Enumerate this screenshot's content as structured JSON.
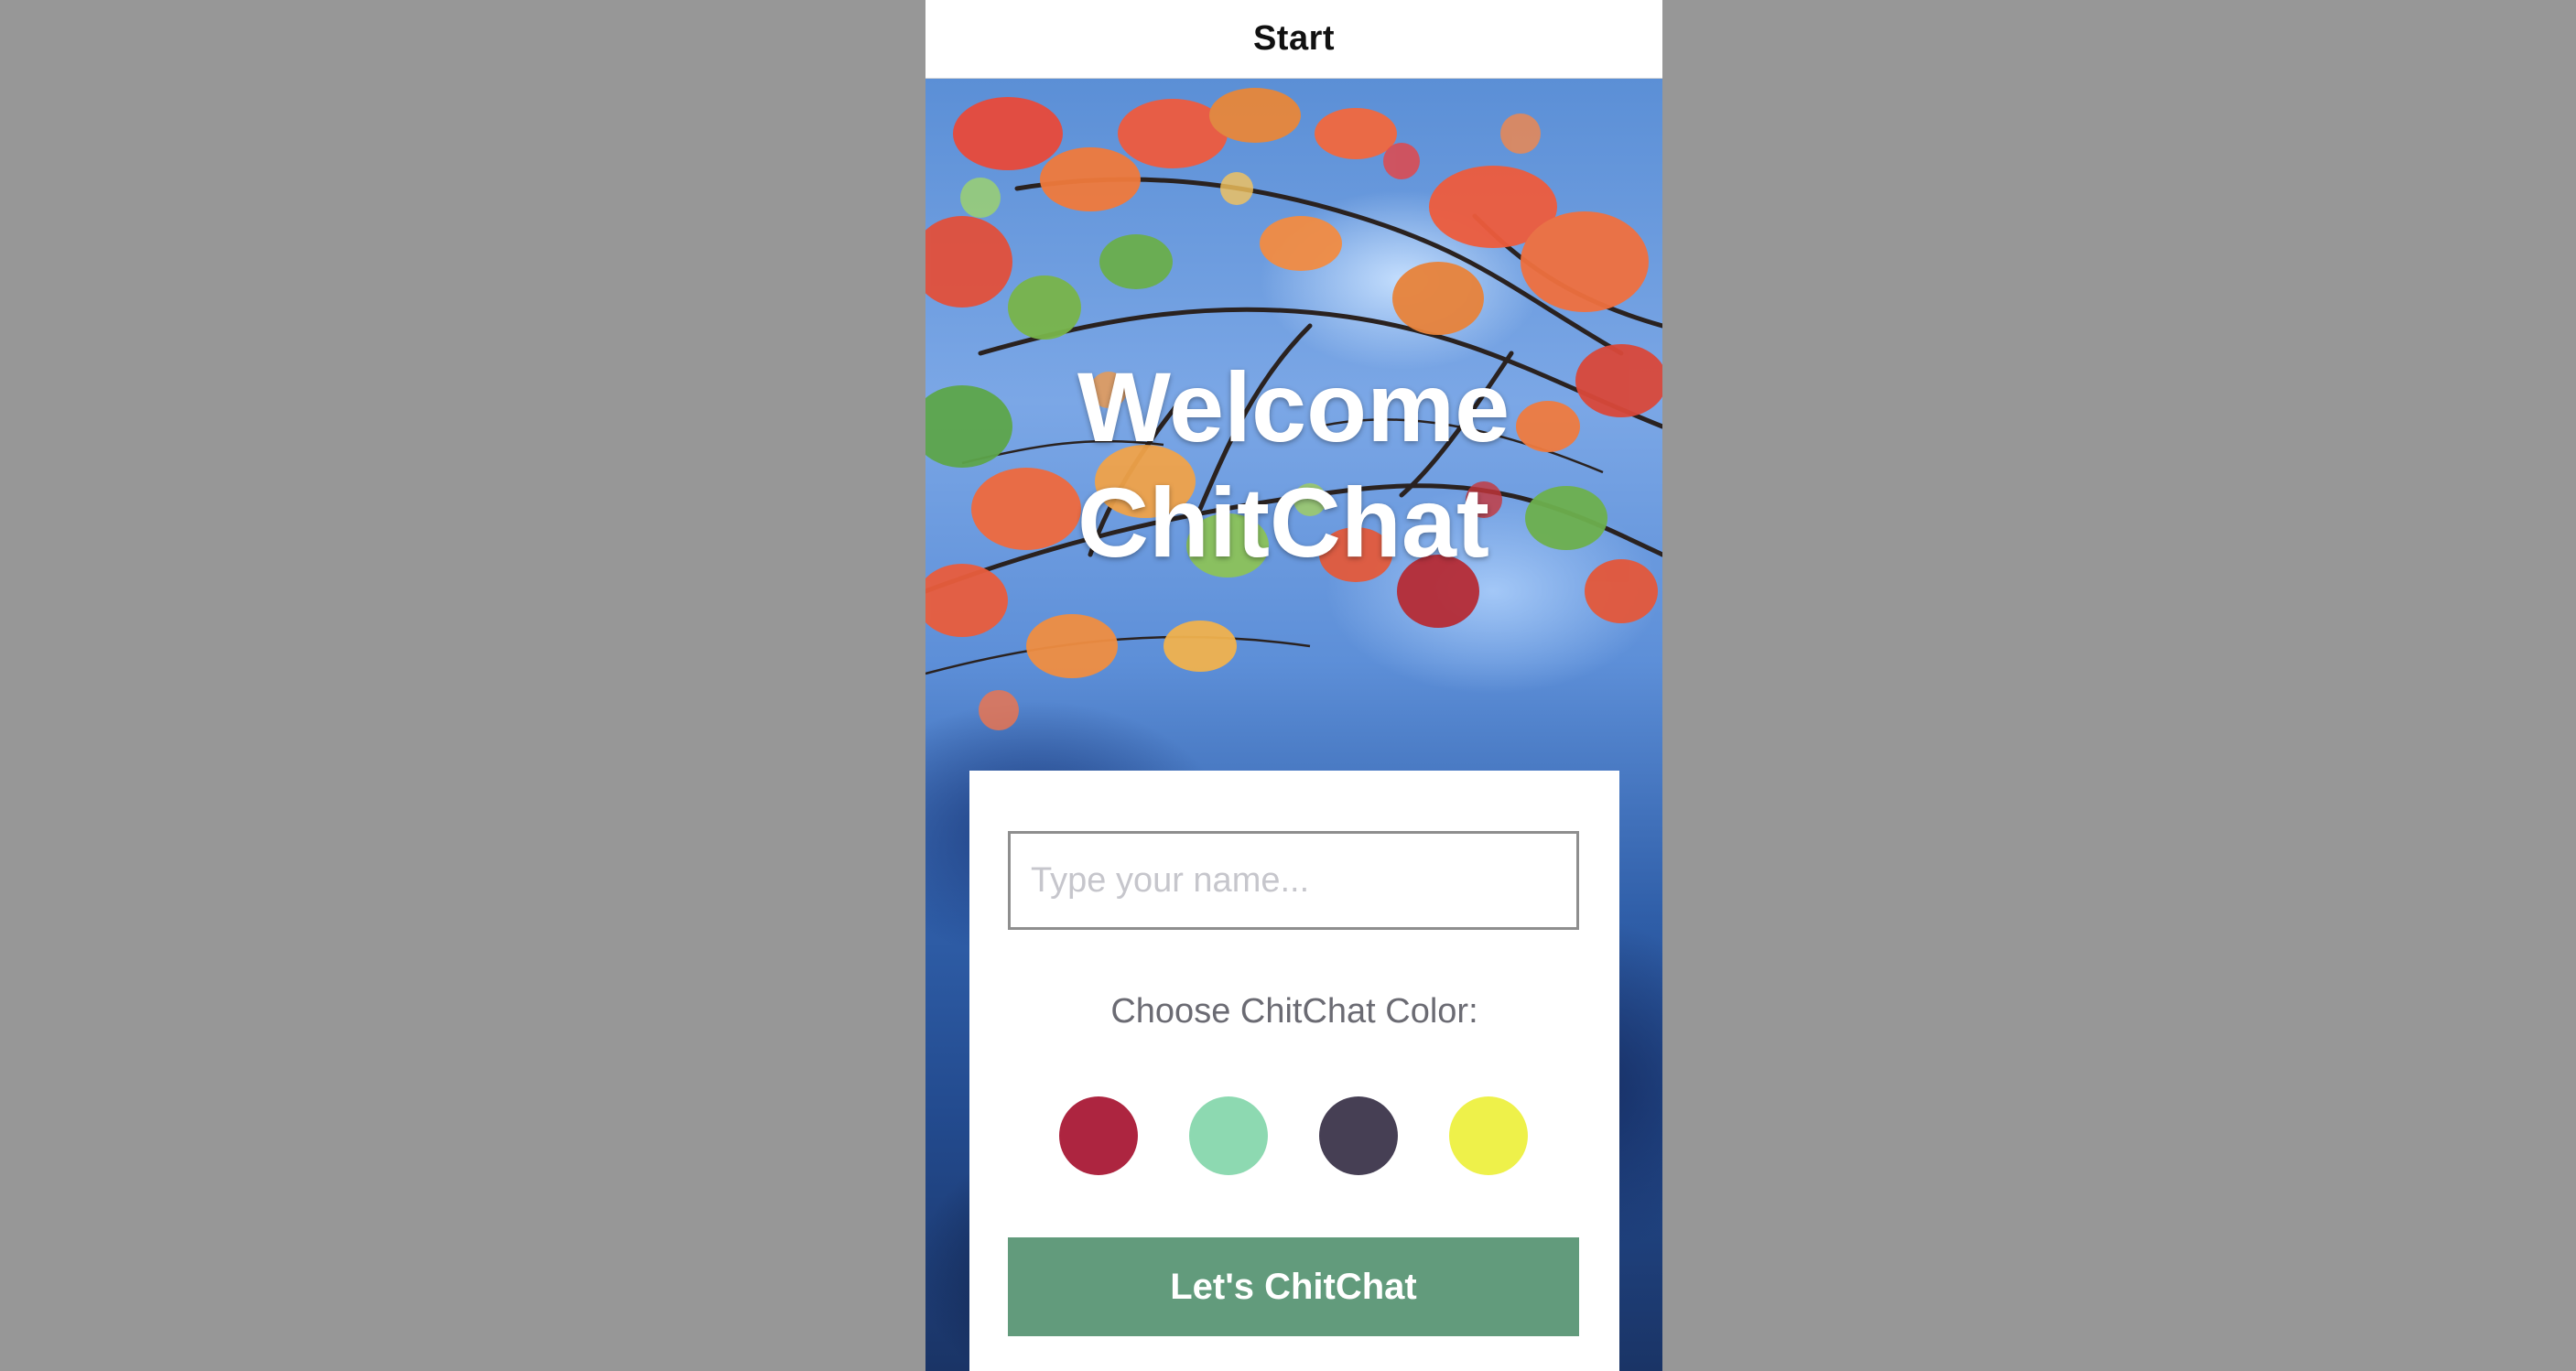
{
  "nav": {
    "title": "Start"
  },
  "hero": {
    "line1": "Welcome",
    "line2": "ChitChat"
  },
  "form": {
    "name_placeholder": "Type your name...",
    "name_value": "",
    "color_label": "Choose ChitChat Color:",
    "colors": [
      {
        "name": "crimson",
        "hex": "#ad2540"
      },
      {
        "name": "mint",
        "hex": "#8dd9b1"
      },
      {
        "name": "charcoal",
        "hex": "#463f54"
      },
      {
        "name": "yellow",
        "hex": "#eef14a"
      }
    ],
    "submit_label": "Let's ChitChat"
  },
  "theme": {
    "button_color": "#629b7c",
    "page_background": "#979797"
  }
}
